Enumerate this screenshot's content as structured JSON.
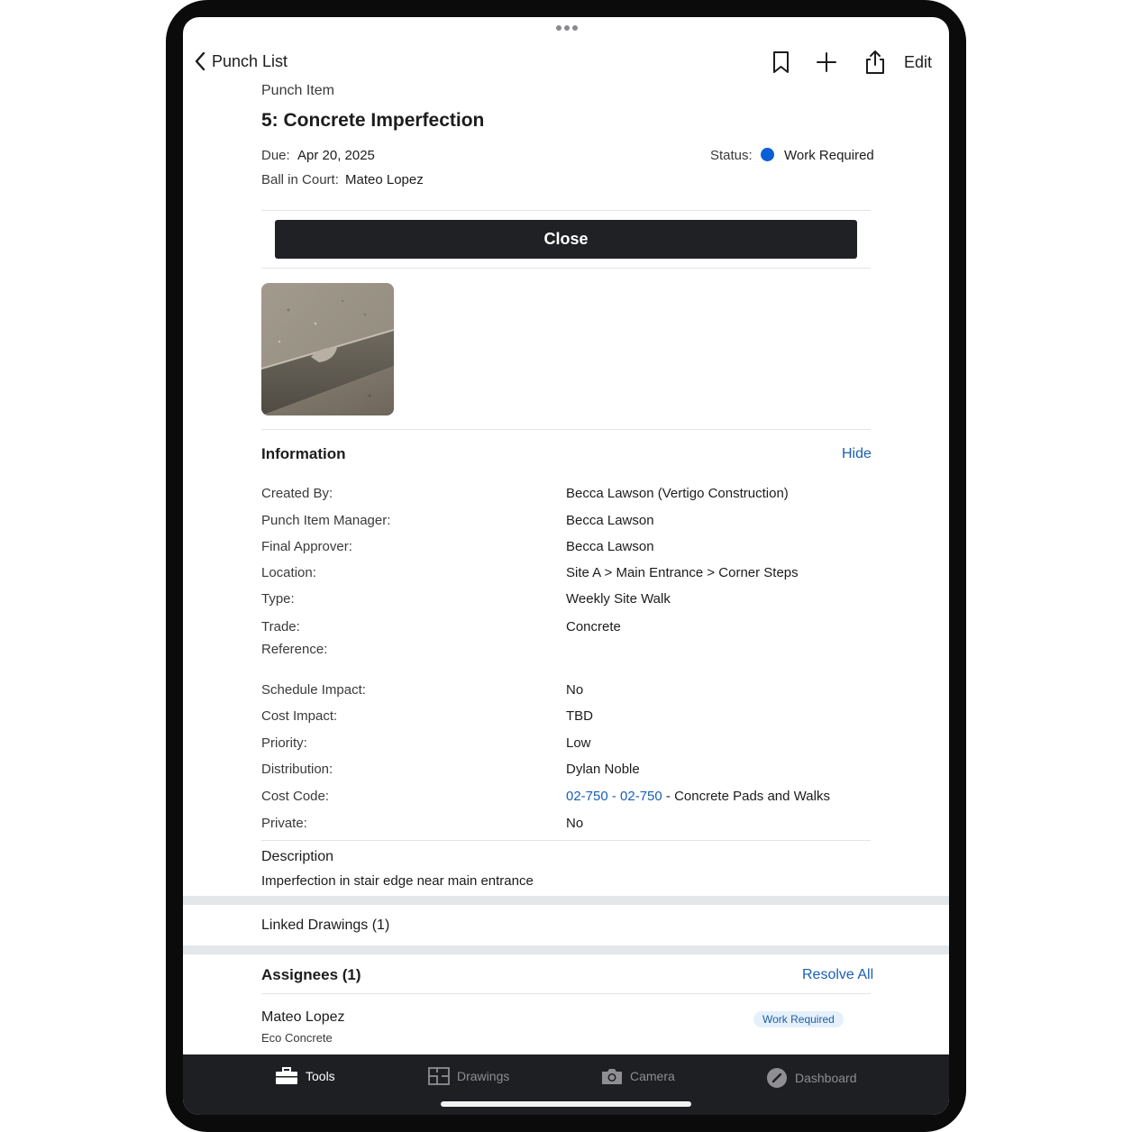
{
  "nav": {
    "back_label": "Punch List",
    "edit_label": "Edit",
    "icons": [
      "bookmark-icon",
      "plus-icon",
      "share-icon"
    ]
  },
  "header": {
    "kicker": "Punch Item",
    "title": "5: Concrete Imperfection",
    "due_label": "Due:",
    "due_value": "Apr 20, 2025",
    "status_label": "Status:",
    "status_value": "Work Required",
    "status_color": "#0b5fd6",
    "bic_label": "Ball in Court:",
    "bic_value": "Mateo Lopez"
  },
  "close_button": "Close",
  "information": {
    "title": "Information",
    "hide_label": "Hide",
    "rows": [
      {
        "label": "Created By:",
        "value": "Becca Lawson (Vertigo Construction)"
      },
      {
        "label": "Punch Item Manager:",
        "value": "Becca Lawson"
      },
      {
        "label": "Final Approver:",
        "value": "Becca Lawson"
      },
      {
        "label": "Location:",
        "value": "Site A > Main Entrance > Corner Steps"
      },
      {
        "label": "Type:",
        "value": "Weekly Site Walk"
      },
      {
        "label": "Trade:",
        "value": "Concrete"
      },
      {
        "label": "Reference:",
        "value": ""
      },
      {
        "label": "Schedule Impact:",
        "value": "No"
      },
      {
        "label": "Cost Impact:",
        "value": "TBD"
      },
      {
        "label": "Priority:",
        "value": "Low"
      },
      {
        "label": "Distribution:",
        "value": "Dylan Noble"
      },
      {
        "label": "Cost Code:",
        "link": "02-750 - 02-750",
        "value": " - Concrete Pads and Walks"
      },
      {
        "label": "Private:",
        "value": "No"
      }
    ]
  },
  "description": {
    "title": "Description",
    "text": "Imperfection in stair edge near main entrance"
  },
  "linked_drawings": "Linked Drawings (1)",
  "assignees": {
    "title": "Assignees (1)",
    "resolve_all": "Resolve All",
    "items": [
      {
        "name": "Mateo Lopez",
        "company": "Eco Concrete",
        "status": "Work Required"
      }
    ]
  },
  "tabbar": {
    "tabs": [
      {
        "label": "Tools",
        "icon": "toolbox-icon",
        "active": true
      },
      {
        "label": "Drawings",
        "icon": "drawings-icon",
        "active": false
      },
      {
        "label": "Camera",
        "icon": "camera-icon",
        "active": false
      },
      {
        "label": "Dashboard",
        "icon": "dashboard-icon",
        "active": false
      }
    ]
  }
}
